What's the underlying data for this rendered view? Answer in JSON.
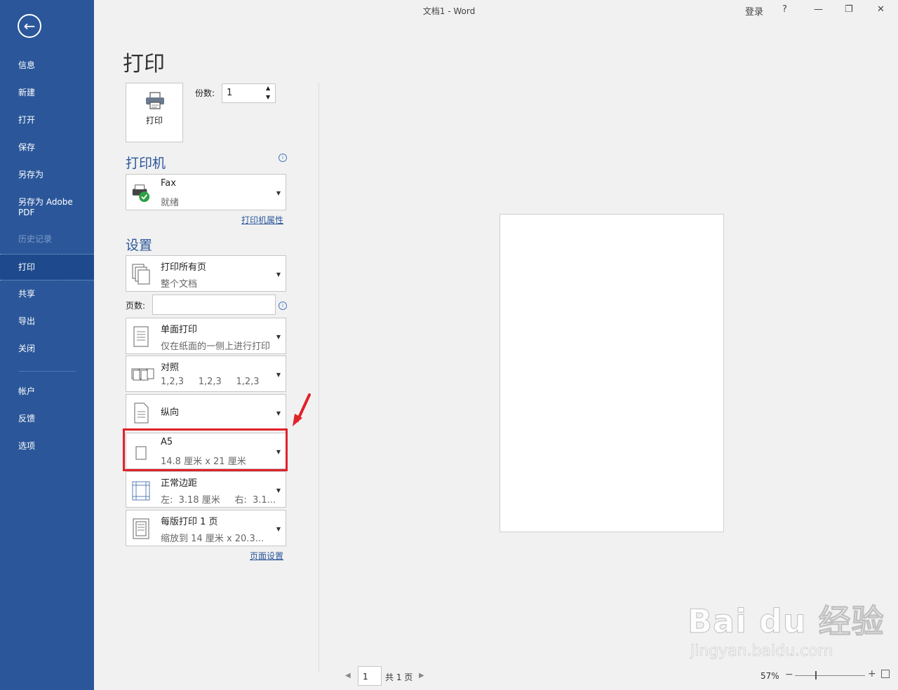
{
  "window": {
    "title": "文档1  -  Word",
    "login": "登录",
    "help": "?",
    "minimize": "—",
    "restore": "❐",
    "close": "✕"
  },
  "sidebar": {
    "back_icon": "←",
    "items": [
      {
        "label": "信息"
      },
      {
        "label": "新建"
      },
      {
        "label": "打开"
      },
      {
        "label": "保存"
      },
      {
        "label": "另存为"
      },
      {
        "label": "另存为 Adobe PDF"
      },
      {
        "label": "历史记录"
      },
      {
        "label": "打印"
      },
      {
        "label": "共享"
      },
      {
        "label": "导出"
      },
      {
        "label": "关闭"
      },
      {
        "label": "帐户"
      },
      {
        "label": "反馈"
      },
      {
        "label": "选项"
      }
    ]
  },
  "print": {
    "heading": "打印",
    "print_button": "打印",
    "copies_label": "份数:",
    "copies_value": "1"
  },
  "printer": {
    "heading": "打印机",
    "name": "Fax",
    "status": "就绪",
    "properties_link": "打印机属性"
  },
  "settings": {
    "heading": "设置",
    "pages_label": "页数:",
    "pages_value": "",
    "options": [
      {
        "line1": "打印所有页",
        "line2": "整个文档"
      },
      {
        "line1": "单面打印",
        "line2": "仅在纸面的一侧上进行打印"
      },
      {
        "line1": "对照",
        "line2": "1,2,3     1,2,3     1,2,3"
      },
      {
        "line1": "纵向",
        "line2": ""
      },
      {
        "line1": "A5",
        "line2": "14.8 厘米 x 21 厘米"
      },
      {
        "line1": "正常边距",
        "line2": "左:  3.18 厘米     右:  3.1..."
      },
      {
        "line1": "每版打印 1 页",
        "line2": "缩放到 14 厘米 x 20.3..."
      }
    ],
    "page_setup_link": "页面设置"
  },
  "footer": {
    "page_value": "1",
    "page_total": "共 1 页",
    "zoom": "57%"
  },
  "watermark": {
    "brand": "Bai du 经验",
    "url": "jingyan.baidu.com"
  },
  "colors": {
    "sidebar": "#2b579a",
    "accent": "#2b579a",
    "highlight": "#e0222a"
  }
}
